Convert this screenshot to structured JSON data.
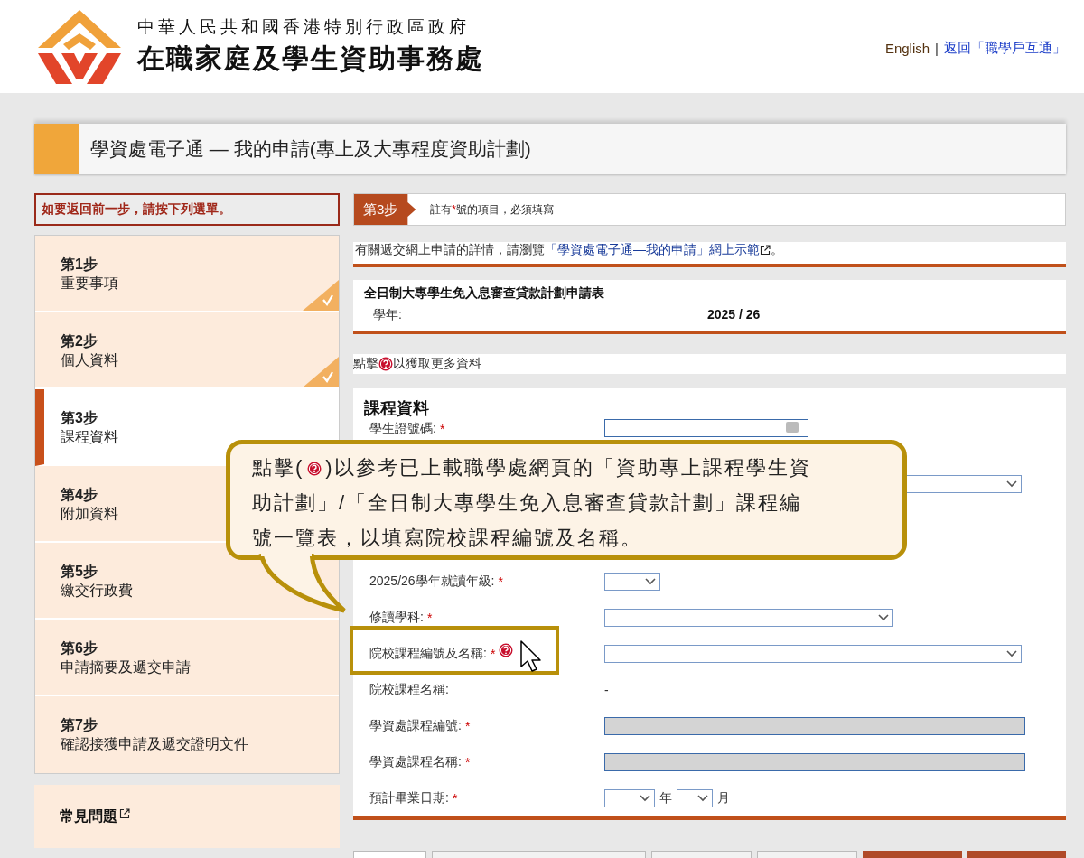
{
  "header": {
    "agency_line1": "中華人民共和國香港特別行政區政府",
    "agency_line2": "在職家庭及學生資助事務處",
    "links": [
      {
        "label": "English",
        "kind": "plain"
      },
      {
        "label": "返回「職學戶互通」",
        "kind": "link"
      }
    ],
    "separator": "|"
  },
  "page_title": "學資處電子通 — 我的申請(專上及大專程度資助計劃)",
  "sidebar": {
    "notice": "如要返回前一步，請按下列選單。",
    "steps": [
      {
        "number": "第1步",
        "name": "重要事項",
        "selected": false,
        "completed": true
      },
      {
        "number": "第2步",
        "name": "個人資料",
        "selected": false,
        "completed": true
      },
      {
        "number": "第3步",
        "name": "課程資料",
        "selected": true,
        "completed": false
      },
      {
        "number": "第4步",
        "name": "附加資料",
        "selected": false,
        "completed": false
      },
      {
        "number": "第5步",
        "name": "繳交行政費",
        "selected": false,
        "completed": false
      },
      {
        "number": "第6步",
        "name": "申請摘要及遞交申請",
        "selected": false,
        "completed": false
      },
      {
        "number": "第7步",
        "name": "確認接獲申請及遞交證明文件",
        "selected": false,
        "completed": false
      }
    ],
    "faq": "常見問題"
  },
  "step_banner": {
    "badge": "第3步",
    "note_prefix": "註有",
    "note_mark": "*",
    "note_suffix": "號的項目，必須填寫"
  },
  "intro": {
    "text": "有關遞交網上申請的詳情，請瀏覽",
    "link": "「學資處電子通—我的申請」網上示範",
    "end": "。"
  },
  "form_header": {
    "title": "全日制大專學生免入息審查貸款計劃申請表",
    "year_label": "學年:",
    "year_value": "2025 / 26"
  },
  "help_hint": {
    "before": "點擊",
    "after": "以獲取更多資料"
  },
  "section": {
    "title": "課程資料",
    "rows": [
      {
        "kind": "text",
        "label": "學生證號碼:",
        "required": true
      },
      {
        "kind": "select"
      },
      {
        "kind": "covered"
      },
      {
        "kind": "select",
        "label": "2025/26學年就讀年級:",
        "required": true
      },
      {
        "kind": "select",
        "label": "修讀學科:",
        "required": true
      },
      {
        "kind": "select",
        "label": "院校課程編號及名稱:",
        "required": true,
        "help": true,
        "highlighted": true
      },
      {
        "kind": "static",
        "label": "院校課程名稱:",
        "required": false,
        "value": "-"
      },
      {
        "kind": "disabled",
        "label": "學資處課程編號:",
        "required": true
      },
      {
        "kind": "disabled",
        "label": "學資處課程名稱:",
        "required": true
      },
      {
        "kind": "date",
        "label": "預計畢業日期:",
        "required": true,
        "year_unit": "年",
        "month_unit": "月"
      }
    ]
  },
  "callout": {
    "lines": [
      {
        "before": "點擊(",
        "after": ")以參考已上載職學處網頁的「資助專上課程學生資"
      },
      {
        "text": "助計劃」/「全日制大專學生免入息審查貸款計劃」課程編"
      },
      {
        "text": "號一覽表，以填寫院校課程編號及名稱。"
      }
    ]
  },
  "footer_buttons": [
    {
      "kind": "light"
    },
    {
      "kind": "grey"
    },
    {
      "kind": "grey"
    },
    {
      "kind": "grey"
    },
    {
      "kind": "primary"
    },
    {
      "kind": "primary"
    }
  ]
}
